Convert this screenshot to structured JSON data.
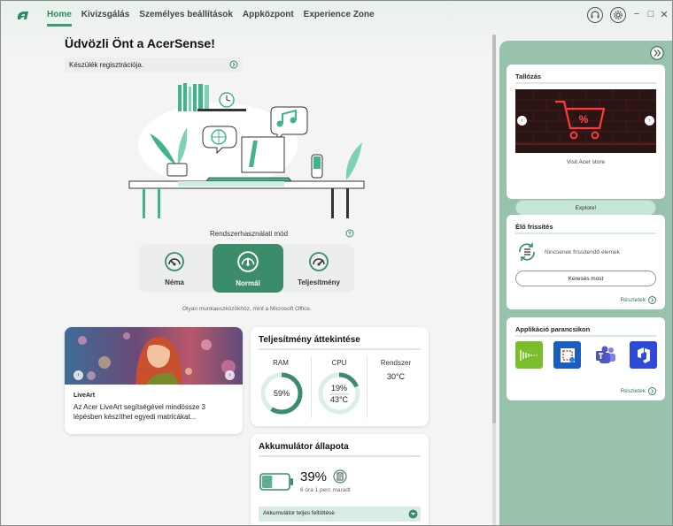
{
  "app": {
    "logo": "acer-a-logo"
  },
  "nav": {
    "items": [
      {
        "label": "Home",
        "active": true
      },
      {
        "label": "Kivizsgálás",
        "active": false
      },
      {
        "label": "Személyes beállítások",
        "active": false
      },
      {
        "label": "Appközpont",
        "active": false
      },
      {
        "label": "Experience Zone",
        "active": false
      }
    ]
  },
  "header_icons": [
    "headset-icon",
    "gear-icon"
  ],
  "window": {
    "minimize": "−",
    "maximize": "□",
    "close": "✕"
  },
  "main": {
    "welcome": "Üdvözli Önt a AcerSense!",
    "register": "Készülék regisztrációja.",
    "mode_title": "Rendszerhasználati mód",
    "modes": [
      {
        "label": "Néma",
        "active": false
      },
      {
        "label": "Normál",
        "active": true
      },
      {
        "label": "Teljesítmény",
        "active": false
      }
    ],
    "mode_desc": "Olyan munkaeszközökhöz, mint a Microsoft Office."
  },
  "liveart": {
    "tag": "LiveArt",
    "desc": "Az Acer LiveArt segítségével mindössze 3 lépésben készíthet egyedi matricákat..."
  },
  "perf": {
    "title": "Teljesítmény áttekintése",
    "ram_label": "RAM",
    "ram_value": "59%",
    "ram_fraction": 0.59,
    "cpu_label": "CPU",
    "cpu_value": "19%",
    "cpu_temp": "43°C",
    "cpu_fraction": 0.19,
    "sys_label": "Rendszer",
    "sys_temp": "30°C"
  },
  "battery": {
    "title": "Akkumulátor állapota",
    "pct": "39%",
    "level": 0.39,
    "remaining": "6 óra 1 perc maradt",
    "full_charge": "Akkumulátor teljes feltöltése"
  },
  "side": {
    "browse_title": "Tallózás",
    "store_caption": "Visit Acer store",
    "explore": "Explore!",
    "live_title": "Élő frissítés",
    "no_updates": "Nincsenek frissítendő elemek",
    "search_now": "Keresés most",
    "details": "Részletek",
    "apps_title": "Applikáció parancsikon",
    "apps": [
      "audio-app-icon",
      "snip-app-icon",
      "teams-icon",
      "azure-devops-icon"
    ]
  },
  "colors": {
    "accent": "#3a8c6b",
    "panel": "#99c2ac",
    "light_accent": "#c6e6d6"
  }
}
